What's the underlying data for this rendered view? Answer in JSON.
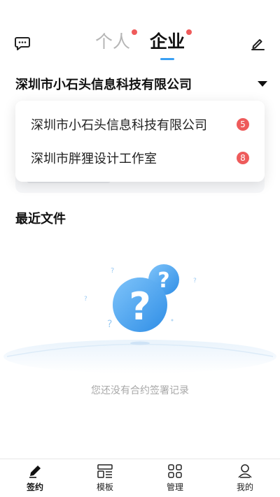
{
  "header": {
    "tabs": [
      {
        "label": "个人",
        "active": false,
        "has_dot": true
      },
      {
        "label": "企业",
        "active": true,
        "has_dot": true
      }
    ],
    "left_icon": "chat-icon",
    "right_icon": "edit-icon"
  },
  "company_selector": {
    "current": "深圳市小石头信息科技有限公司",
    "caret_icon": "caret-down-icon"
  },
  "dropdown": {
    "items": [
      {
        "label": "深圳市小石头信息科技有限公司",
        "badge": "5"
      },
      {
        "label": "深圳市胖狸设计工作室",
        "badge": "8"
      }
    ]
  },
  "recent_files": {
    "title": "最近文件",
    "empty_text": "您还没有合约签署记录"
  },
  "bottom_nav": {
    "items": [
      {
        "label": "签约",
        "icon": "pen-icon",
        "active": true
      },
      {
        "label": "模板",
        "icon": "template-icon",
        "active": false
      },
      {
        "label": "管理",
        "icon": "grid-icon",
        "active": false
      },
      {
        "label": "我的",
        "icon": "user-icon",
        "active": false
      }
    ]
  },
  "colors": {
    "accent": "#3aa0f3",
    "badge": "#ee5b5b",
    "text": "#222222",
    "muted": "#a8a8a8"
  }
}
